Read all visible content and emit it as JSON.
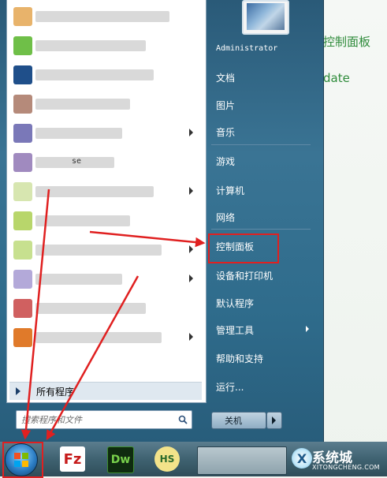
{
  "desktop": {
    "bg_text_1": "NVIDIA 控制面板",
    "bg_text_1_visible": "控制面板",
    "bg_text_2": "Windows Update",
    "bg_text_2_visible": "date"
  },
  "start_menu": {
    "left_programs": [
      {
        "text": "",
        "has_arrow": false,
        "icon_color": "#e8b36b"
      },
      {
        "text": "",
        "has_arrow": false,
        "icon_color": "#6fbf48"
      },
      {
        "text": "",
        "has_arrow": false,
        "icon_color": "#1f4f8a"
      },
      {
        "text": "",
        "has_arrow": false,
        "icon_color": "#b58a7a"
      },
      {
        "text": "",
        "has_arrow": true,
        "icon_color": "#7a78b8"
      },
      {
        "text": "se",
        "has_arrow": false,
        "icon_color": "#a08abf"
      },
      {
        "text": "",
        "has_arrow": true,
        "icon_color": "#d7e6b0"
      },
      {
        "text": "",
        "has_arrow": false,
        "icon_color": "#b8d66b"
      },
      {
        "text": "",
        "has_arrow": true,
        "icon_color": "#c7e08f"
      },
      {
        "text": "",
        "has_arrow": true,
        "icon_color": "#b3a9d9"
      },
      {
        "text": "",
        "has_arrow": false,
        "icon_color": "#d06060"
      },
      {
        "text": "",
        "has_arrow": true,
        "icon_color": "#e07a2a"
      }
    ],
    "all_programs_label": "所有程序",
    "search_placeholder": "搜索程序和文件",
    "username": "Administrator",
    "right_items": [
      {
        "label": "文档",
        "has_arrow": false
      },
      {
        "label": "图片",
        "has_arrow": false
      },
      {
        "label": "音乐",
        "has_arrow": false
      },
      {
        "label": "游戏",
        "has_arrow": false
      },
      {
        "label": "计算机",
        "has_arrow": false
      },
      {
        "label": "网络",
        "has_arrow": false
      },
      {
        "label": "控制面板",
        "has_arrow": false
      },
      {
        "label": "设备和打印机",
        "has_arrow": false
      },
      {
        "label": "默认程序",
        "has_arrow": false
      },
      {
        "label": "管理工具",
        "has_arrow": true
      },
      {
        "label": "帮助和支持",
        "has_arrow": false
      },
      {
        "label": "运行...",
        "has_arrow": false
      }
    ],
    "shutdown_label": "关机"
  },
  "taskbar": {
    "fz_label": "Fz",
    "dw_label": "Dw",
    "hs_label": "HS"
  },
  "watermark": {
    "brand": "系统城",
    "site": "XITONGCHENG.COM",
    "logo_letter": "X"
  },
  "colors": {
    "highlight": "#e02020",
    "menu_blue": "#2f6c8c",
    "bg_green_text": "#2e8b3a"
  }
}
